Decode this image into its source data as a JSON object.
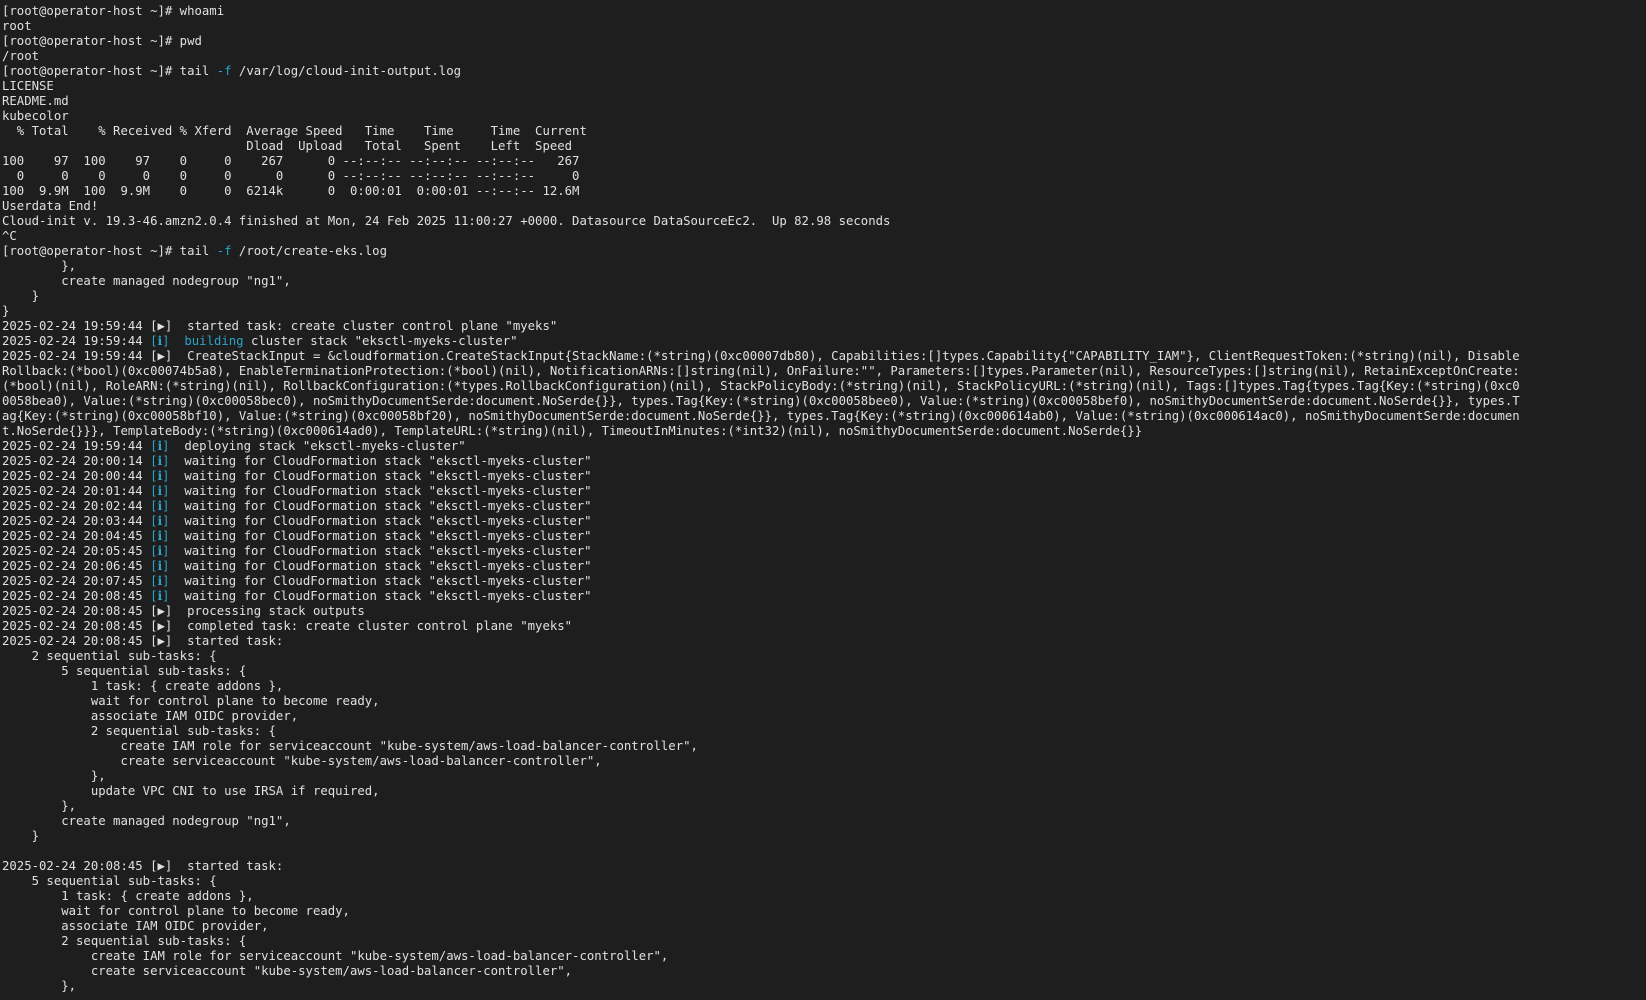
{
  "terminal": {
    "bg_color": "#1e1e1e",
    "fg_color": "#e0e0e0",
    "accent_color": "#2aa3c7",
    "lines": [
      [
        {
          "t": "[root@operator-host ~]# whoami"
        }
      ],
      [
        {
          "t": "root"
        }
      ],
      [
        {
          "t": "[root@operator-host ~]# pwd"
        }
      ],
      [
        {
          "t": "/root"
        }
      ],
      [
        {
          "t": "[root@operator-host ~]# tail "
        },
        {
          "t": "-f",
          "c": "cyan"
        },
        {
          "t": " /var/log/cloud-init-output.log"
        }
      ],
      [
        {
          "t": "LICENSE"
        }
      ],
      [
        {
          "t": "README.md"
        }
      ],
      [
        {
          "t": "kubecolor"
        }
      ],
      [
        {
          "t": "  % Total    % Received % Xferd  Average Speed   Time    Time     Time  Current"
        }
      ],
      [
        {
          "t": "                                 Dload  Upload   Total   Spent    Left  Speed"
        }
      ],
      [
        {
          "t": "100    97  100    97    0     0    267      0 --:--:-- --:--:-- --:--:--   267"
        }
      ],
      [
        {
          "t": "  0     0    0     0    0     0      0      0 --:--:-- --:--:-- --:--:--     0"
        }
      ],
      [
        {
          "t": "100  9.9M  100  9.9M    0     0  6214k      0  0:00:01  0:00:01 --:--:-- 12.6M"
        }
      ],
      [
        {
          "t": "Userdata End!"
        }
      ],
      [
        {
          "t": "Cloud-init v. 19.3-46.amzn2.0.4 finished at Mon, 24 Feb 2025 11:00:27 +0000. Datasource DataSourceEc2.  Up 82.98 seconds"
        }
      ],
      [
        {
          "t": "^C"
        }
      ],
      [
        {
          "t": "[root@operator-host ~]# tail "
        },
        {
          "t": "-f",
          "c": "cyan"
        },
        {
          "t": " /root/create-eks.log"
        }
      ],
      [
        {
          "t": "        },"
        }
      ],
      [
        {
          "t": "        create managed nodegroup \"ng1\","
        }
      ],
      [
        {
          "t": "    }"
        }
      ],
      [
        {
          "t": "}"
        }
      ],
      [
        {
          "t": "2025-02-24 19:59:44 [▶]  started task: create cluster control plane \"myeks\""
        }
      ],
      [
        {
          "t": "2025-02-24 19:59:44 "
        },
        {
          "t": "[ℹ]  building",
          "c": "cyan"
        },
        {
          "t": " cluster stack \"eksctl-myeks-cluster\""
        }
      ],
      [
        {
          "t": "2025-02-24 19:59:44 [▶]  CreateStackInput = &cloudformation.CreateStackInput{StackName:(*string)(0xc00007db80), Capabilities:[]types.Capability{\"CAPABILITY_IAM\"}, ClientRequestToken:(*string)(nil), Disable"
        }
      ],
      [
        {
          "t": "Rollback:(*bool)(0xc00074b5a8), EnableTerminationProtection:(*bool)(nil), NotificationARNs:[]string(nil), OnFailure:\"\", Parameters:[]types.Parameter(nil), ResourceTypes:[]string(nil), RetainExceptOnCreate:"
        }
      ],
      [
        {
          "t": "(*bool)(nil), RoleARN:(*string)(nil), RollbackConfiguration:(*types.RollbackConfiguration)(nil), StackPolicyBody:(*string)(nil), StackPolicyURL:(*string)(nil), Tags:[]types.Tag{types.Tag{Key:(*string)(0xc0"
        }
      ],
      [
        {
          "t": "0058bea0), Value:(*string)(0xc00058bec0), noSmithyDocumentSerde:document.NoSerde{}}, types.Tag{Key:(*string)(0xc00058bee0), Value:(*string)(0xc00058bef0), noSmithyDocumentSerde:document.NoSerde{}}, types.T"
        }
      ],
      [
        {
          "t": "ag{Key:(*string)(0xc00058bf10), Value:(*string)(0xc00058bf20), noSmithyDocumentSerde:document.NoSerde{}}, types.Tag{Key:(*string)(0xc000614ab0), Value:(*string)(0xc000614ac0), noSmithyDocumentSerde:documen"
        }
      ],
      [
        {
          "t": "t.NoSerde{}}}, TemplateBody:(*string)(0xc000614ad0), TemplateURL:(*string)(nil), TimeoutInMinutes:(*int32)(nil), noSmithyDocumentSerde:document.NoSerde{}}"
        }
      ],
      [
        {
          "t": "2025-02-24 19:59:44 "
        },
        {
          "t": "[ℹ]",
          "c": "cyan"
        },
        {
          "t": "  deploying stack \"eksctl-myeks-cluster\""
        }
      ],
      [
        {
          "t": "2025-02-24 20:00:14 "
        },
        {
          "t": "[ℹ]",
          "c": "cyan"
        },
        {
          "t": "  waiting for CloudFormation stack \"eksctl-myeks-cluster\""
        }
      ],
      [
        {
          "t": "2025-02-24 20:00:44 "
        },
        {
          "t": "[ℹ]",
          "c": "cyan"
        },
        {
          "t": "  waiting for CloudFormation stack \"eksctl-myeks-cluster\""
        }
      ],
      [
        {
          "t": "2025-02-24 20:01:44 "
        },
        {
          "t": "[ℹ]",
          "c": "cyan"
        },
        {
          "t": "  waiting for CloudFormation stack \"eksctl-myeks-cluster\""
        }
      ],
      [
        {
          "t": "2025-02-24 20:02:44 "
        },
        {
          "t": "[ℹ]",
          "c": "cyan"
        },
        {
          "t": "  waiting for CloudFormation stack \"eksctl-myeks-cluster\""
        }
      ],
      [
        {
          "t": "2025-02-24 20:03:44 "
        },
        {
          "t": "[ℹ]",
          "c": "cyan"
        },
        {
          "t": "  waiting for CloudFormation stack \"eksctl-myeks-cluster\""
        }
      ],
      [
        {
          "t": "2025-02-24 20:04:45 "
        },
        {
          "t": "[ℹ]",
          "c": "cyan"
        },
        {
          "t": "  waiting for CloudFormation stack \"eksctl-myeks-cluster\""
        }
      ],
      [
        {
          "t": "2025-02-24 20:05:45 "
        },
        {
          "t": "[ℹ]",
          "c": "cyan"
        },
        {
          "t": "  waiting for CloudFormation stack \"eksctl-myeks-cluster\""
        }
      ],
      [
        {
          "t": "2025-02-24 20:06:45 "
        },
        {
          "t": "[ℹ]",
          "c": "cyan"
        },
        {
          "t": "  waiting for CloudFormation stack \"eksctl-myeks-cluster\""
        }
      ],
      [
        {
          "t": "2025-02-24 20:07:45 "
        },
        {
          "t": "[ℹ]",
          "c": "cyan"
        },
        {
          "t": "  waiting for CloudFormation stack \"eksctl-myeks-cluster\""
        }
      ],
      [
        {
          "t": "2025-02-24 20:08:45 "
        },
        {
          "t": "[ℹ]",
          "c": "cyan"
        },
        {
          "t": "  waiting for CloudFormation stack \"eksctl-myeks-cluster\""
        }
      ],
      [
        {
          "t": "2025-02-24 20:08:45 [▶]  processing stack outputs"
        }
      ],
      [
        {
          "t": "2025-02-24 20:08:45 [▶]  completed task: create cluster control plane \"myeks\""
        }
      ],
      [
        {
          "t": "2025-02-24 20:08:45 [▶]  started task:"
        }
      ],
      [
        {
          "t": "    2 sequential sub-tasks: {"
        }
      ],
      [
        {
          "t": "        5 sequential sub-tasks: {"
        }
      ],
      [
        {
          "t": "            1 task: { create addons },"
        }
      ],
      [
        {
          "t": "            wait for control plane to become ready,"
        }
      ],
      [
        {
          "t": "            associate IAM OIDC provider,"
        }
      ],
      [
        {
          "t": "            2 sequential sub-tasks: {"
        }
      ],
      [
        {
          "t": "                create IAM role for serviceaccount \"kube-system/aws-load-balancer-controller\","
        }
      ],
      [
        {
          "t": "                create serviceaccount \"kube-system/aws-load-balancer-controller\","
        }
      ],
      [
        {
          "t": "            },"
        }
      ],
      [
        {
          "t": "            update VPC CNI to use IRSA if required,"
        }
      ],
      [
        {
          "t": "        },"
        }
      ],
      [
        {
          "t": "        create managed nodegroup \"ng1\","
        }
      ],
      [
        {
          "t": "    }"
        }
      ],
      [
        {
          "t": ""
        }
      ],
      [
        {
          "t": "2025-02-24 20:08:45 [▶]  started task:"
        }
      ],
      [
        {
          "t": "    5 sequential sub-tasks: {"
        }
      ],
      [
        {
          "t": "        1 task: { create addons },"
        }
      ],
      [
        {
          "t": "        wait for control plane to become ready,"
        }
      ],
      [
        {
          "t": "        associate IAM OIDC provider,"
        }
      ],
      [
        {
          "t": "        2 sequential sub-tasks: {"
        }
      ],
      [
        {
          "t": "            create IAM role for serviceaccount \"kube-system/aws-load-balancer-controller\","
        }
      ],
      [
        {
          "t": "            create serviceaccount \"kube-system/aws-load-balancer-controller\","
        }
      ],
      [
        {
          "t": "        },"
        }
      ]
    ]
  }
}
